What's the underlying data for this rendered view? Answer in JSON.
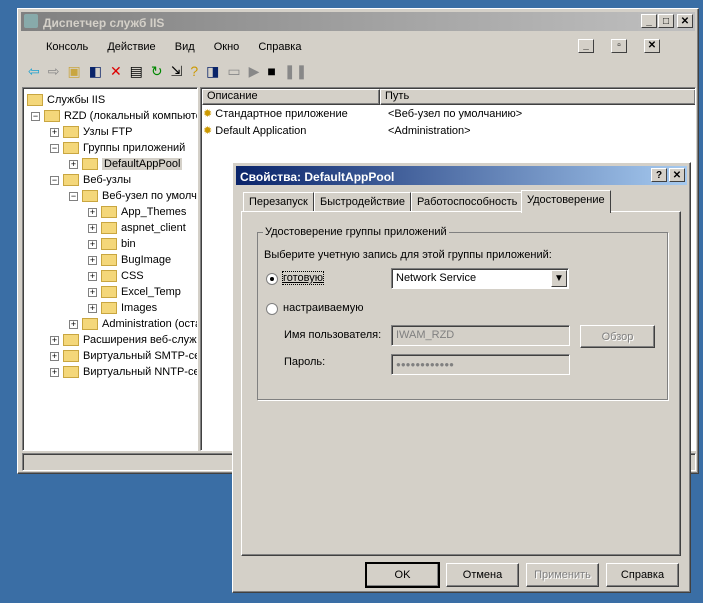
{
  "main_window": {
    "title": "Диспетчер служб IIS",
    "menu": [
      "Консоль",
      "Действие",
      "Вид",
      "Окно",
      "Справка"
    ],
    "tree": [
      {
        "label": "Службы IIS",
        "level": 0
      },
      {
        "label": "RZD (локальный компьютер)",
        "level": 1
      },
      {
        "label": "Узлы FTP",
        "level": 2
      },
      {
        "label": "Группы приложений",
        "level": 2
      },
      {
        "label": "DefaultAppPool",
        "level": 3,
        "selected": true
      },
      {
        "label": "Веб-узлы",
        "level": 2
      },
      {
        "label": "Веб-узел по умолчанию",
        "level": 3
      },
      {
        "label": "App_Themes",
        "level": 4
      },
      {
        "label": "aspnet_client",
        "level": 4
      },
      {
        "label": "bin",
        "level": 4
      },
      {
        "label": "BugImage",
        "level": 4
      },
      {
        "label": "CSS",
        "level": 4
      },
      {
        "label": "Excel_Temp",
        "level": 4
      },
      {
        "label": "Images",
        "level": 4
      },
      {
        "label": "Administration (остановлен)",
        "level": 3
      },
      {
        "label": "Расширения веб-служб",
        "level": 2
      },
      {
        "label": "Виртуальный SMTP-сервер",
        "level": 2
      },
      {
        "label": "Виртуальный NNTP-сервер",
        "level": 2
      }
    ],
    "list": {
      "columns": [
        "Описание",
        "Путь"
      ],
      "rows": [
        [
          "Стандартное приложение",
          "<Веб-узел по умолчанию>"
        ],
        [
          "Default Application",
          "<Administration>"
        ]
      ]
    }
  },
  "dialog": {
    "title": "Свойства: DefaultAppPool",
    "tabs": [
      "Перезапуск",
      "Быстродействие",
      "Работоспособность",
      "Удостоверение"
    ],
    "active_tab": "Удостоверение",
    "group_title": "Удостоверение группы приложений",
    "prompt": "Выберите учетную запись для этой группы приложений:",
    "radio_predefined": "готовую",
    "radio_configurable": "настраиваемую",
    "selected_radio": "готовую",
    "account_value": "Network Service",
    "username_label": "Имя пользователя:",
    "username_value": "IWAM_RZD",
    "password_label": "Пароль:",
    "password_value": "●●●●●●●●●●●●",
    "browse_label": "Обзор",
    "buttons": {
      "ok": "OK",
      "cancel": "Отмена",
      "apply": "Применить",
      "help": "Справка"
    }
  }
}
